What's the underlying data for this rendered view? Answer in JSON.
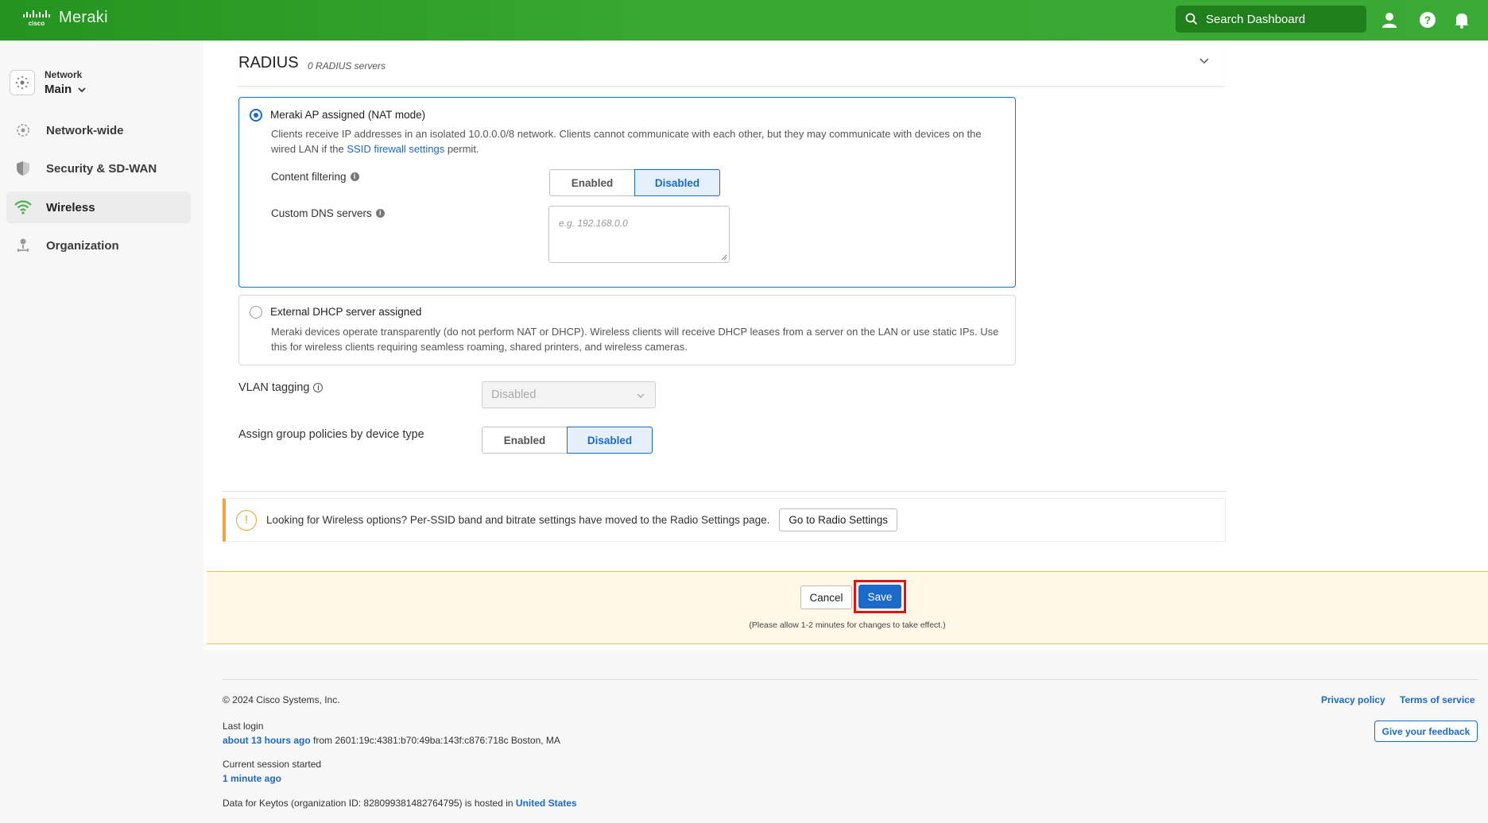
{
  "topbar": {
    "brand": "Meraki",
    "search_placeholder": "Search Dashboard",
    "accent": "#38a832"
  },
  "sidebar": {
    "network_label": "Network",
    "network_value": "Main",
    "items": [
      {
        "label": "Network-wide",
        "icon": "network-wide-icon"
      },
      {
        "label": "Security & SD-WAN",
        "icon": "shield-icon"
      },
      {
        "label": "Wireless",
        "icon": "wifi-icon",
        "active": true
      },
      {
        "label": "Organization",
        "icon": "organization-icon"
      }
    ]
  },
  "radius": {
    "title": "RADIUS",
    "subtitle": "0 RADIUS servers"
  },
  "nat_option": {
    "title": "Meraki AP assigned (NAT mode)",
    "desc_before": "Clients receive IP addresses in an isolated 10.0.0.0/8 network. Clients cannot communicate with each other, but they may communicate with devices on the wired LAN if the ",
    "desc_link": "SSID firewall settings",
    "desc_after": " permit.",
    "content_filtering_label": "Content filtering",
    "enabled_label": "Enabled",
    "disabled_label": "Disabled",
    "content_filtering_value": "Disabled",
    "dns_label": "Custom DNS servers",
    "dns_placeholder": "e.g. 192.168.0.0",
    "selected": true
  },
  "dhcp_option": {
    "title": "External DHCP server assigned",
    "desc": "Meraki devices operate transparently (do not perform NAT or DHCP). Wireless clients will receive DHCP leases from a server on the LAN or use static IPs. Use this for wireless clients requiring seamless roaming, shared printers, and wireless cameras.",
    "selected": false
  },
  "vlan": {
    "label": "VLAN tagging",
    "value": "Disabled"
  },
  "group_policies": {
    "label": "Assign group policies by device type",
    "enabled_label": "Enabled",
    "disabled_label": "Disabled",
    "value": "Disabled"
  },
  "banner": {
    "text": "Looking for Wireless options? Per-SSID band and bitrate settings have moved to the Radio Settings page.",
    "button": "Go to Radio Settings"
  },
  "savebar": {
    "cancel": "Cancel",
    "save": "Save",
    "note": "(Please allow 1-2 minutes for changes to take effect.)"
  },
  "footer": {
    "copyright": "© 2024 Cisco Systems, Inc.",
    "privacy": "Privacy policy",
    "terms": "Terms of service",
    "last_login_label": "Last login",
    "last_login_when": "about 13 hours ago",
    "last_login_from": " from 2601:19c:4381:b70:49ba:143f:c876:718c Boston, MA",
    "feedback": "Give your feedback",
    "session_label": "Current session started",
    "session_when": "1 minute ago",
    "data_for": "Data for Keytos (organization ID: 828099381482764795) is hosted in ",
    "region": "United States"
  }
}
